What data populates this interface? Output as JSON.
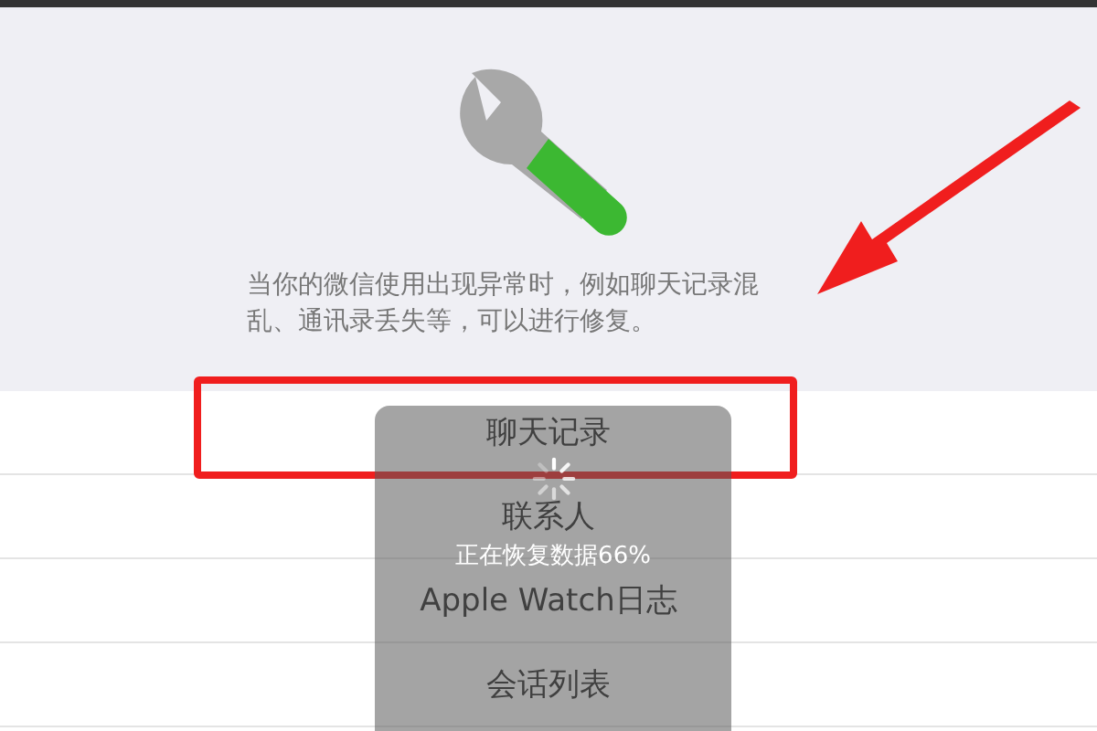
{
  "description": "当你的微信使用出现异常时，例如聊天记录混乱、通讯录丢失等，可以进行修复。",
  "items": [
    {
      "label": "聊天记录",
      "highlighted": true
    },
    {
      "label": "联系人",
      "highlighted": false
    },
    {
      "label": "Apple Watch日志",
      "highlighted": false
    },
    {
      "label": "会话列表",
      "highlighted": false
    }
  ],
  "toast": {
    "message": "正在恢复数据66%"
  }
}
